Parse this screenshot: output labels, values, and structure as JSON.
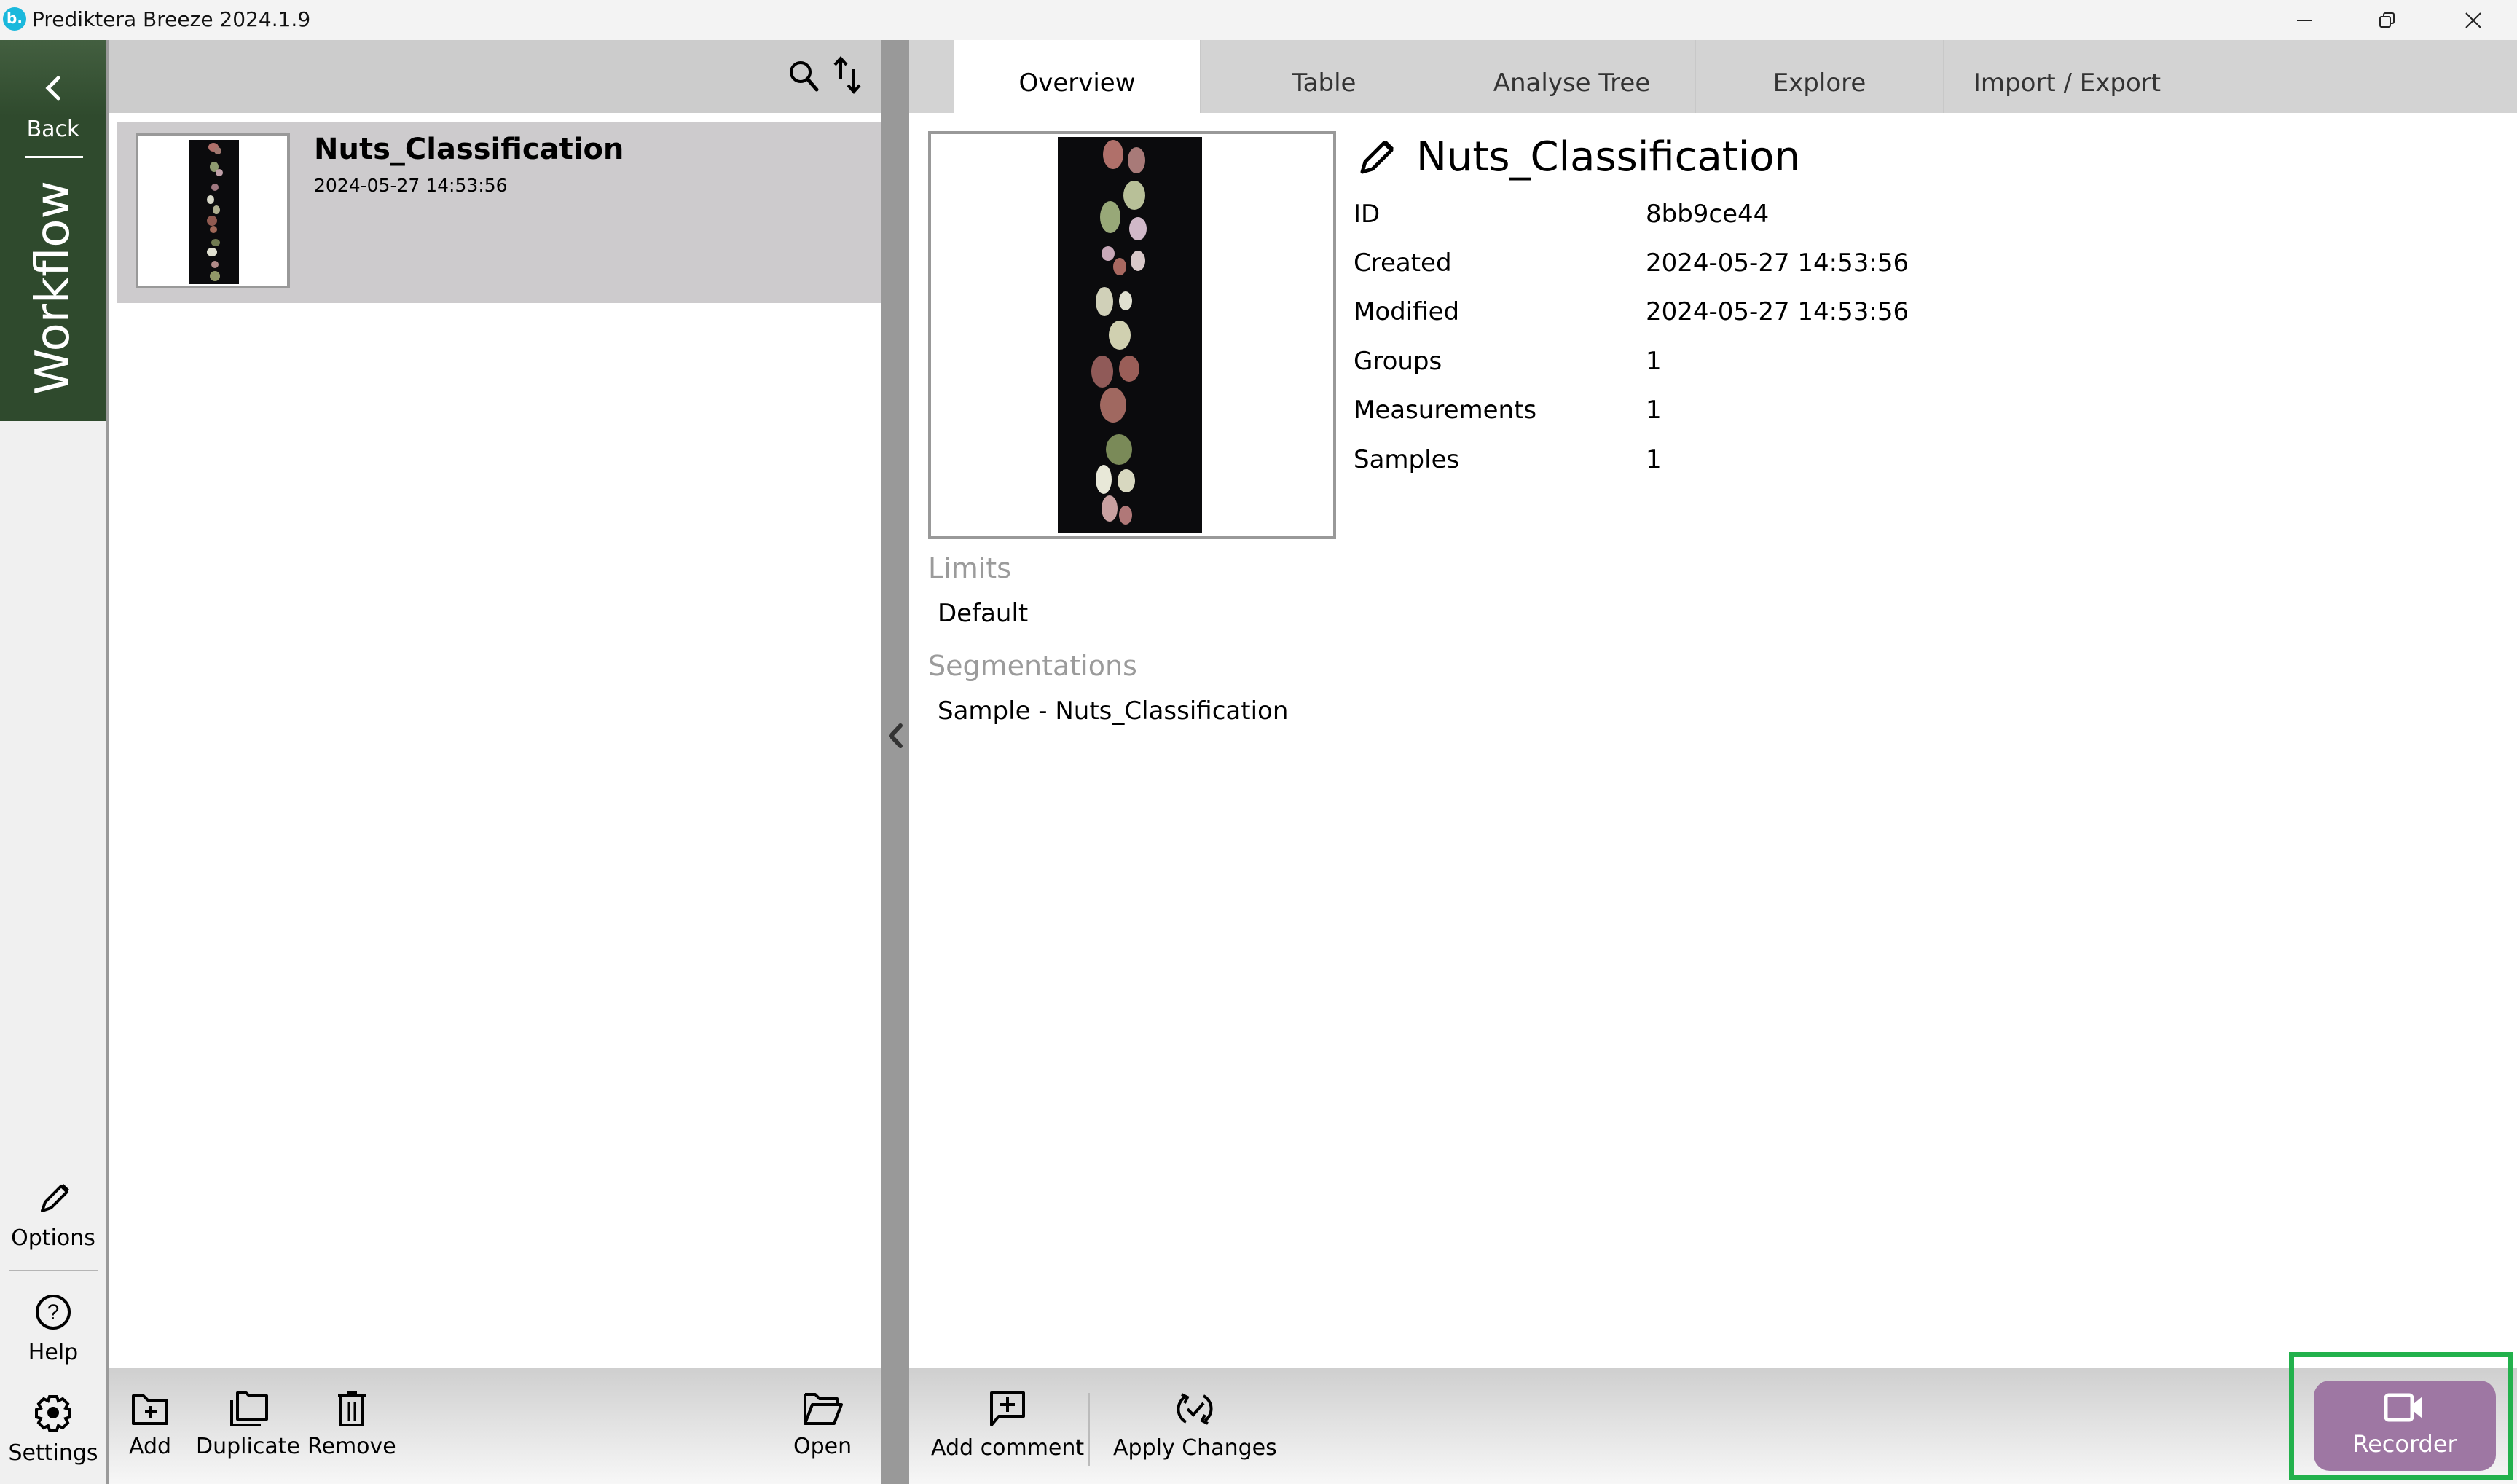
{
  "window": {
    "title": "Prediktera Breeze 2024.1.9",
    "logo_text": "b.",
    "controls": [
      "minimize",
      "restore",
      "close"
    ]
  },
  "nav": {
    "back_label": "Back",
    "section_label": "Workflow",
    "accent_color": "#2f4a2d",
    "bottom_items": [
      {
        "label": "Options",
        "icon": "pencil-icon"
      },
      {
        "label": "Help",
        "icon": "help-circle-icon"
      },
      {
        "label": "Settings",
        "icon": "gear-icon"
      }
    ]
  },
  "list": {
    "header_icons": [
      "search-icon",
      "sort-icon"
    ],
    "items": [
      {
        "title": "Nuts_Classification",
        "date": "2024-05-27 14:53:56",
        "selected": true
      }
    ],
    "toolbar": {
      "add_label": "Add",
      "duplicate_label": "Duplicate",
      "remove_label": "Remove",
      "open_label": "Open"
    }
  },
  "tabs": [
    {
      "label": "Overview",
      "active": true
    },
    {
      "label": "Table",
      "active": false
    },
    {
      "label": "Analyse Tree",
      "active": false
    },
    {
      "label": "Explore",
      "active": false
    },
    {
      "label": "Import / Export",
      "active": false
    }
  ],
  "overview": {
    "title": "Nuts_Classification",
    "properties": [
      {
        "label": "ID",
        "value": "8bb9ce44"
      },
      {
        "label": "Created",
        "value": "2024-05-27 14:53:56"
      },
      {
        "label": "Modified",
        "value": "2024-05-27 14:53:56"
      },
      {
        "label": "Groups",
        "value": "1"
      },
      {
        "label": "Measurements",
        "value": "1"
      },
      {
        "label": "Samples",
        "value": "1"
      }
    ],
    "limits_heading": "Limits",
    "limits": [
      "Default"
    ],
    "segmentations_heading": "Segmentations",
    "segmentations": [
      "Sample - Nuts_Classification"
    ]
  },
  "right_toolbar": {
    "add_comment_label": "Add comment",
    "apply_changes_label": "Apply Changes",
    "recorder_label": "Recorder",
    "recorder_color": "#9e77a3",
    "highlight_color": "#22b14c"
  }
}
